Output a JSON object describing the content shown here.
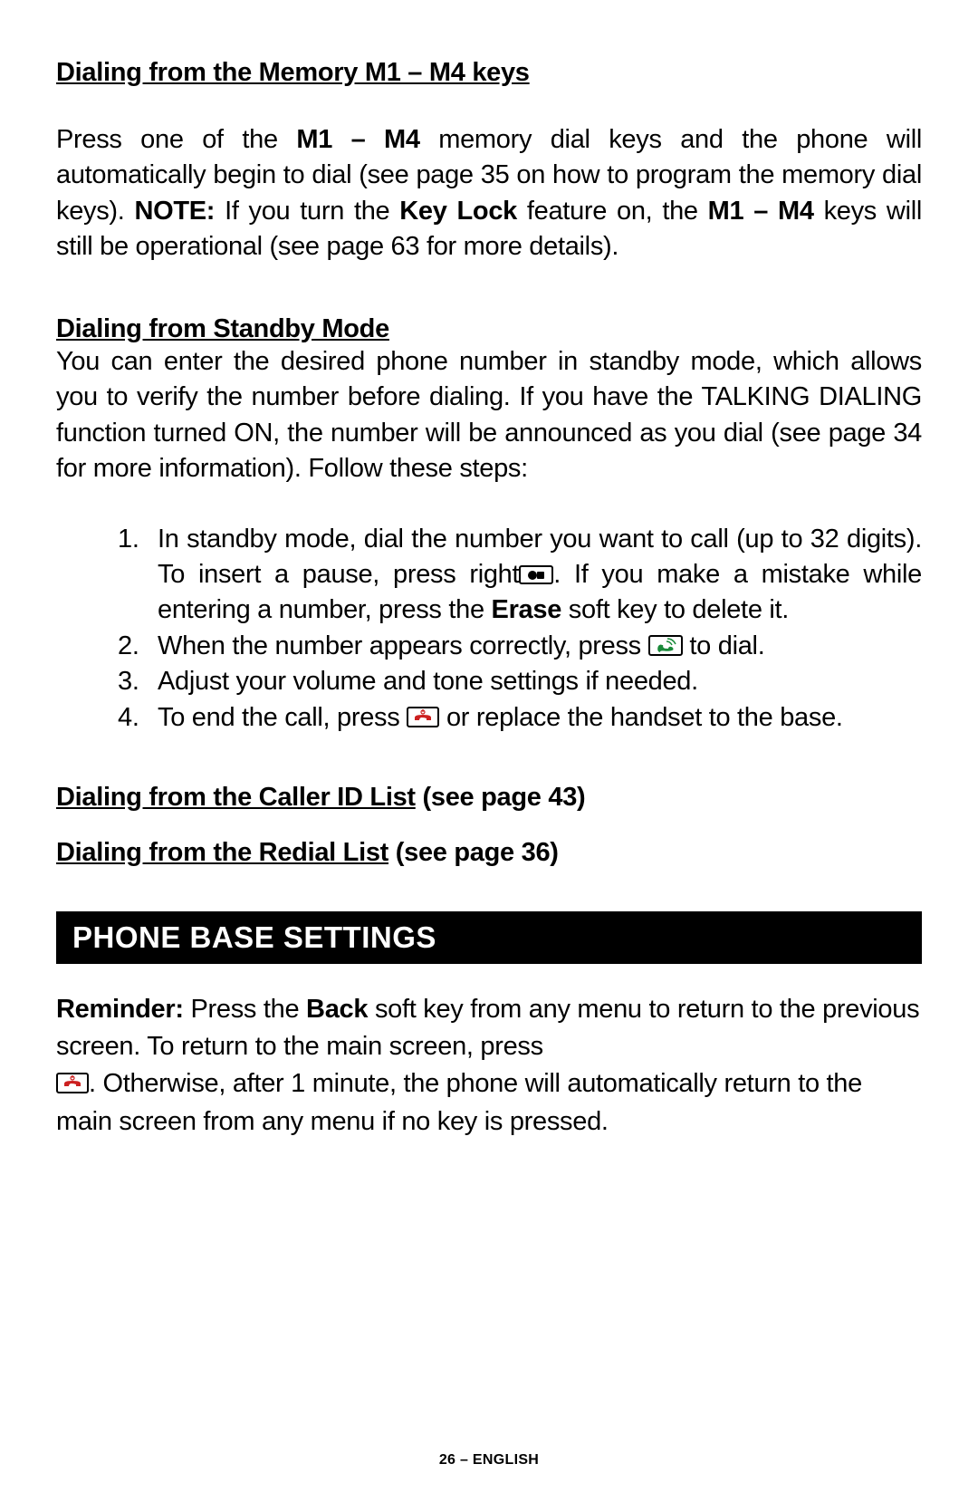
{
  "section1": {
    "heading": "Dialing from the Memory M1 – M4 keys",
    "p1a": "Press one of the ",
    "p1b": "M1 – M4",
    "p1c": " memory dial keys and the phone will automatically begin to dial (see page 35 on how to program the memory dial keys).  ",
    "p1d": "NOTE:",
    "p1e": " If you turn the ",
    "p1f": "Key Lock",
    "p1g": " feature on, the ",
    "p1h": "M1 – M4",
    "p1i": " keys will still be operational (see page 63 for more details)."
  },
  "section2": {
    "heading": "Dialing from Standby Mode",
    "p1": "You can enter the desired phone number in standby mode, which allows you to verify the number before dialing. If you have the TALKING DIALING function turned ON, the number will be announced as you dial (see page 34 for more information). Follow these steps:",
    "step1a": "In standby mode, dial the number you want to call (up to 32 digits).  To insert a pause, press right",
    "step1b": ".  If you make a mistake while entering a number, press the ",
    "step1c": "Erase",
    "step1d": " soft key to delete it.",
    "step2a": "When the number appears correctly, press ",
    "step2b": " to dial.",
    "step3": "Adjust your volume and tone settings if needed.",
    "step4a": "To end the call, press ",
    "step4b": " or replace the handset to the base."
  },
  "ref1": {
    "u": "Dialing from the Caller ID List",
    "rest": " (see page 43)"
  },
  "ref2": {
    "u": "Dialing from the Redial List",
    "rest": " (see page 36)"
  },
  "sectionBar": "PHONE BASE SETTINGS",
  "reminder": {
    "a": "Reminder:",
    "b": " Press the ",
    "c": "Back",
    "d": " soft key from any menu to return to the previous screen.  To return to the main screen, press ",
    "e": ".  Otherwise, after 1 minute, the phone will automatically return to the main screen from any menu if no key is pressed."
  },
  "footer": "26 – ENGLISH",
  "icons": {
    "record": "record-key-icon",
    "talk": "talk-key-icon",
    "end": "end-call-key-icon"
  }
}
